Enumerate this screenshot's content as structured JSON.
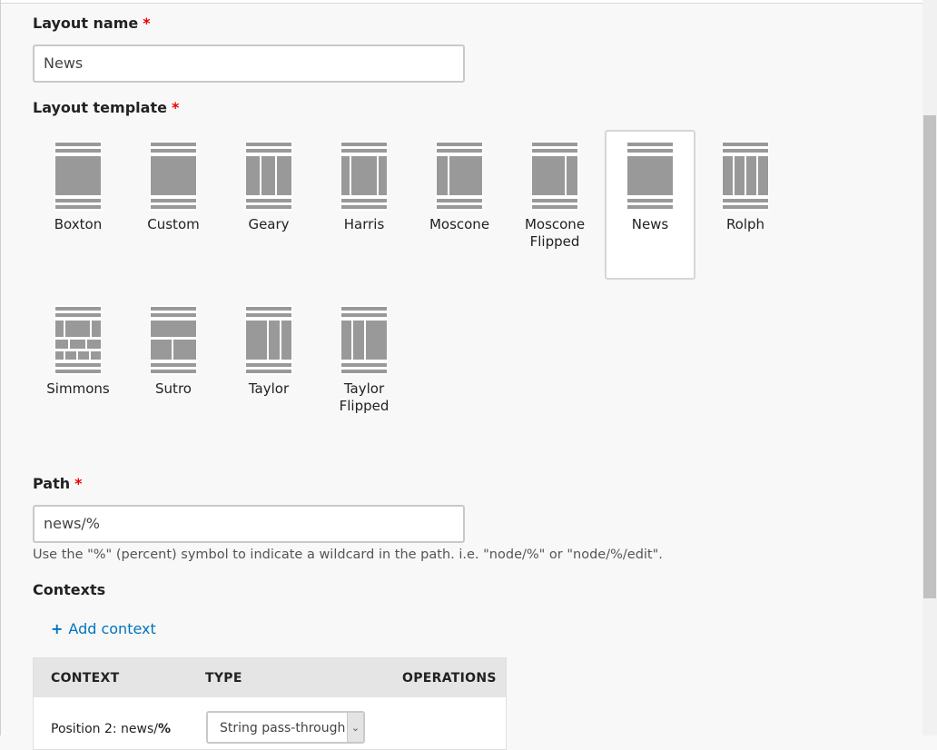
{
  "form": {
    "layout_name_label": "Layout name",
    "required_mark": "*",
    "layout_name_value": "News",
    "layout_template_label": "Layout template",
    "path_label": "Path",
    "path_value": "news/%",
    "path_help": "Use the \"%\" (percent) symbol to indicate a wildcard in the path. i.e. \"node/%\" or \"node/%/edit\".",
    "contexts_label": "Contexts",
    "add_context": "Add context",
    "add_context_icon": "+"
  },
  "templates": [
    {
      "name": "Boxton"
    },
    {
      "name": "Custom"
    },
    {
      "name": "Geary"
    },
    {
      "name": "Harris"
    },
    {
      "name": "Moscone"
    },
    {
      "name": "Moscone Flipped"
    },
    {
      "name": "News",
      "selected": true
    },
    {
      "name": "Rolph"
    },
    {
      "name": "Simmons"
    },
    {
      "name": "Sutro"
    },
    {
      "name": "Taylor"
    },
    {
      "name": "Taylor Flipped"
    }
  ],
  "contexts_table": {
    "headers": [
      "CONTEXT",
      "TYPE",
      "OPERATIONS"
    ],
    "rows": [
      {
        "context_prefix": "Position 2: news/",
        "context_bold": "%",
        "type": "String pass-through"
      }
    ]
  },
  "colors": {
    "required": "#ee0000",
    "link": "#0074bd",
    "icon_gray": "#999999"
  }
}
